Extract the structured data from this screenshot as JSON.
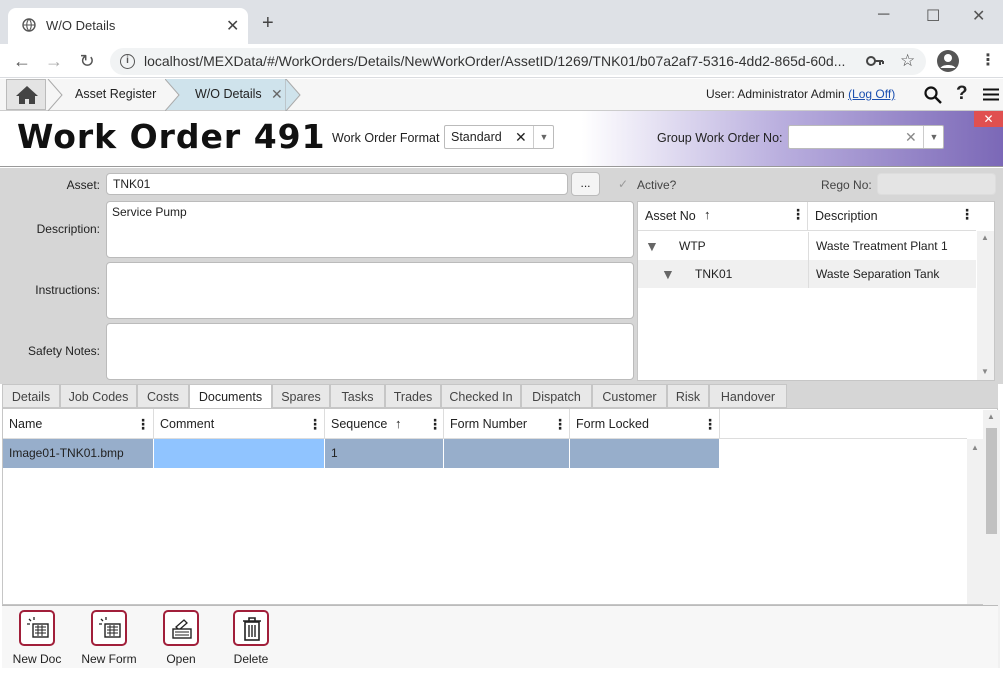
{
  "browser": {
    "tab_title": "W/O Details",
    "url": "localhost/MEXData/#/WorkOrders/Details/NewWorkOrder/AssetID/1269/TNK01/b07a2af7-5316-4dd2-865d-60d..."
  },
  "appnav": {
    "crumbs": [
      "Asset Register",
      "W/O Details"
    ],
    "user_prefix": "User: Administrator Admin",
    "logout": "(Log Off)"
  },
  "header": {
    "title": "Work Order 491",
    "format_label": "Work Order Format",
    "format_value": "Standard",
    "group_label": "Group Work Order No:",
    "group_value": ""
  },
  "form": {
    "asset_label": "Asset:",
    "asset_value": "TNK01",
    "browse": "...",
    "active_label": "Active?",
    "rego_label": "Rego No:",
    "rego_value": "",
    "description_label": "Description:",
    "description_value": "Service Pump",
    "instructions_label": "Instructions:",
    "instructions_value": "",
    "safety_label": "Safety Notes:",
    "safety_value": ""
  },
  "asset_tree": {
    "col_asset_no": "Asset No",
    "col_description": "Description",
    "rows": [
      {
        "asset_no": "WTP",
        "description": "Waste Treatment Plant 1"
      },
      {
        "asset_no": "TNK01",
        "description": "Waste Separation Tank"
      }
    ]
  },
  "tabs": [
    "Details",
    "Job Codes",
    "Costs",
    "Documents",
    "Spares",
    "Tasks",
    "Trades",
    "Checked In",
    "Dispatch",
    "Customer",
    "Risk",
    "Handover"
  ],
  "active_tab": "Documents",
  "documents": {
    "columns": [
      "Name",
      "Comment",
      "Sequence",
      "Form Number",
      "Form Locked"
    ],
    "rows": [
      {
        "name": "Image01-TNK01.bmp",
        "comment": "",
        "sequence": "1",
        "form_number": "",
        "form_locked": ""
      }
    ]
  },
  "toolbar": {
    "new_doc": "New Doc",
    "new_form": "New Form",
    "open": "Open",
    "delete": "Delete"
  },
  "colors": {
    "accent": "#a11f3a",
    "selected_row": "#97aecb",
    "selected_cell": "#90c4ff",
    "crumb_active": "#cfe3ec"
  }
}
